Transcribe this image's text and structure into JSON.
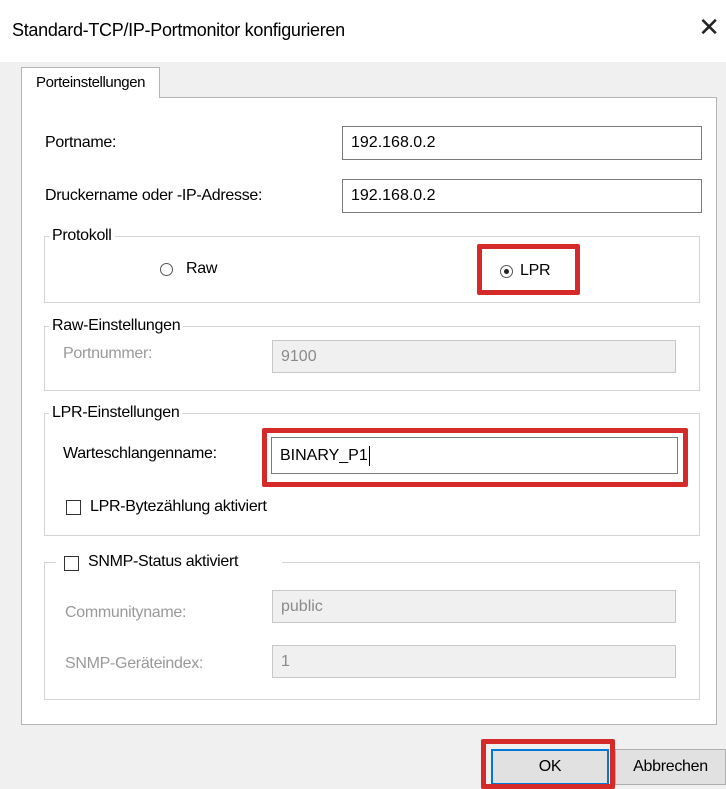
{
  "window": {
    "title": "Standard-TCP/IP-Portmonitor konfigurieren",
    "close_glyph": "✕"
  },
  "tabs": [
    {
      "label": "Porteinstellungen",
      "active": true
    }
  ],
  "port_settings": {
    "portname_label": "Portname:",
    "portname_value": "192.168.0.2",
    "printer_label": "Druckername oder -IP-Adresse:",
    "printer_value": "192.168.0.2"
  },
  "protocol": {
    "legend": "Protokoll",
    "raw_label": "Raw",
    "lpr_label": "LPR",
    "selected": "LPR"
  },
  "raw_settings": {
    "legend": "Raw-Einstellungen",
    "portnumber_label": "Portnummer:",
    "portnumber_value": "9100"
  },
  "lpr_settings": {
    "legend": "LPR-Einstellungen",
    "queue_label": "Warteschlangenname:",
    "queue_value": "BINARY_P1",
    "bytecount_label": "LPR-Bytezählung aktiviert",
    "bytecount_checked": false
  },
  "snmp": {
    "checkbox_label": "SNMP-Status aktiviert",
    "checked": false,
    "community_label": "Communityname:",
    "community_value": "public",
    "device_index_label": "SNMP-Geräteindex:",
    "device_index_value": "1"
  },
  "buttons": {
    "ok": "OK",
    "cancel": "Abbrechen"
  },
  "highlight_color": "#d42a2a"
}
